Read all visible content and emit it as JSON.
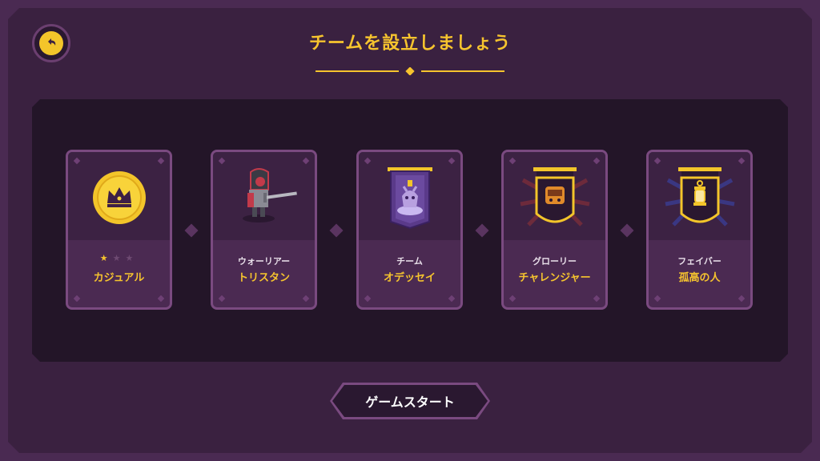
{
  "header": {
    "title": "チームを設立しましょう",
    "back_icon": "back-arrow-icon"
  },
  "colors": {
    "accent": "#f6c42e",
    "background": "#3a2140",
    "panel": "#231528",
    "card": "#4b2a52"
  },
  "cards": [
    {
      "subtitle": "",
      "name": "カジュアル",
      "icon": "crown-coin-icon",
      "stars": {
        "filled": 1,
        "total": 3
      }
    },
    {
      "subtitle": "ウォーリアー",
      "name": "トリスタン",
      "icon": "knight-warrior-icon"
    },
    {
      "subtitle": "チーム",
      "name": "オデッセイ",
      "icon": "team-banner-icon"
    },
    {
      "subtitle": "グローリー",
      "name": "チャレンジャー",
      "icon": "glory-banner-icon"
    },
    {
      "subtitle": "フェイバー",
      "name": "孤高の人",
      "icon": "lantern-banner-icon"
    }
  ],
  "footer": {
    "start_label": "ゲームスタート"
  }
}
